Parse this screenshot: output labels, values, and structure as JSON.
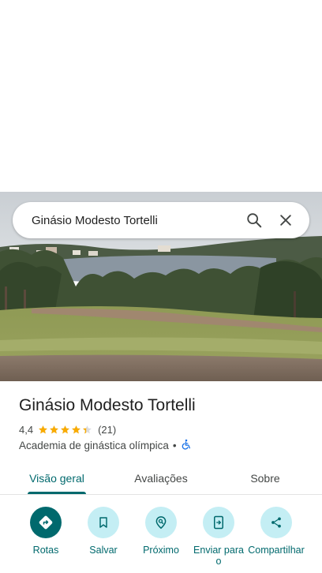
{
  "search": {
    "query": "Ginásio Modesto Tortelli",
    "search_icon": "search-icon",
    "close_icon": "close-icon"
  },
  "place": {
    "title": "Ginásio Modesto Tortelli",
    "rating": "4,4",
    "stars": 4.4,
    "review_count": "(21)",
    "category": "Academia de ginástica olímpica",
    "separator": "•",
    "accessibility_icon": "wheelchair-icon"
  },
  "tabs": [
    {
      "label": "Visão geral",
      "active": true
    },
    {
      "label": "Avaliações",
      "active": false
    },
    {
      "label": "Sobre",
      "active": false
    }
  ],
  "actions": [
    {
      "label": "Rotas",
      "icon": "directions-icon"
    },
    {
      "label": "Salvar",
      "icon": "bookmark-icon"
    },
    {
      "label": "Próximo",
      "icon": "nearby-icon"
    },
    {
      "label": "Enviar para o",
      "icon": "send-to-phone-icon"
    },
    {
      "label": "Compartilhar",
      "icon": "share-icon"
    }
  ],
  "colors": {
    "accent": "#00696d",
    "action_bg": "#c4eef4",
    "star": "#f9ab00"
  }
}
